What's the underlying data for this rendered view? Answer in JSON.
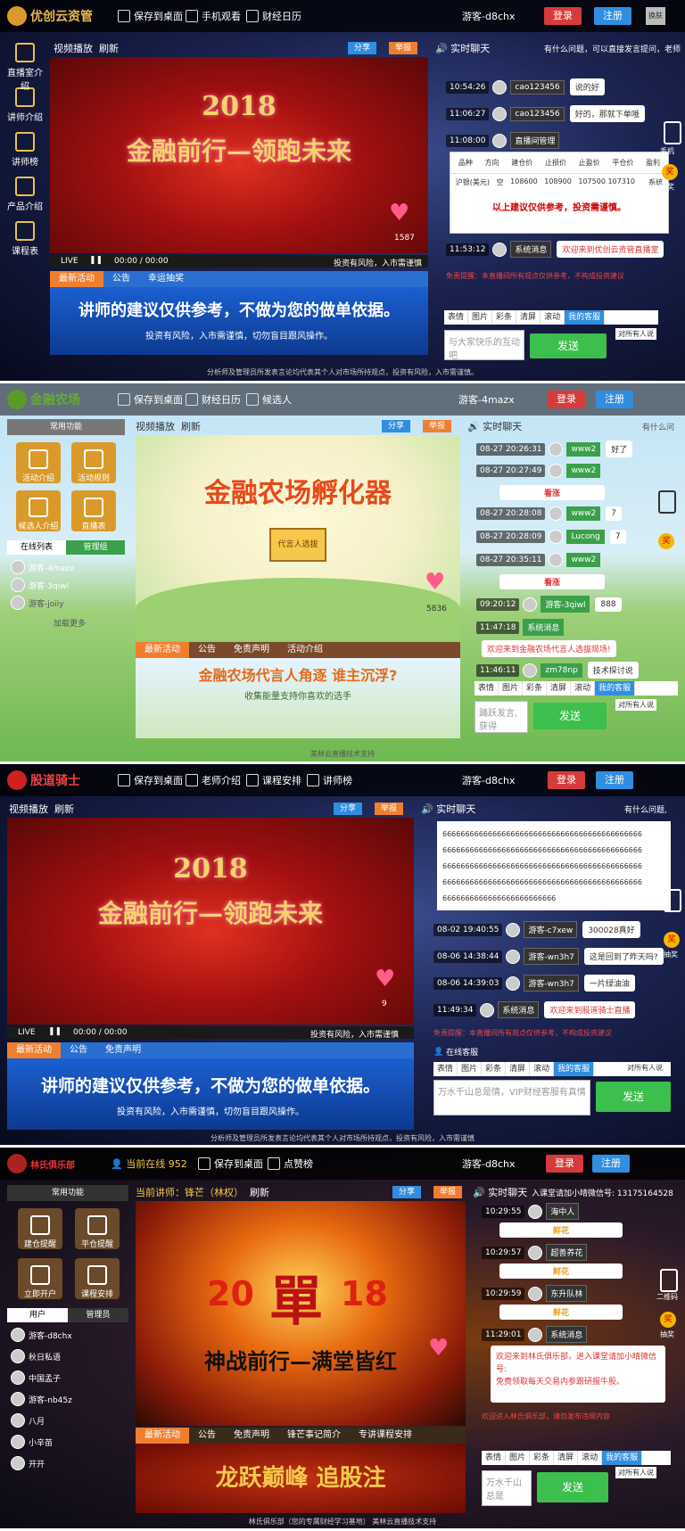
{
  "panel1": {
    "logo": "优创云资管",
    "nav": [
      "保存到桌面",
      "手机观看",
      "财经日历"
    ],
    "guest": "游客-d8chx",
    "login": "登录",
    "register": "注册",
    "small_btn": "换肤",
    "sidebar": [
      "直播室介绍",
      "讲师介绍",
      "讲师榜",
      "产品介绍",
      "课程表"
    ],
    "video_title": "视频播放",
    "refresh": "刷新",
    "share": "分享",
    "report": "举报",
    "video_year": "2018",
    "video_slogan": "金融前行—领跑未来",
    "likes": "1587",
    "live": "LIVE",
    "time": "00:00 / 00:00",
    "risk": "投资有风险，入市需谨慎",
    "tabs": [
      "最新活动",
      "公告",
      "幸运抽奖"
    ],
    "banner_main": "讲师的建议仅供参考，不做为您的做单依据。",
    "banner_sub": "投资有风险，入市需谨慎，切勿盲目跟风操作。",
    "chat_title": "实时聊天",
    "chat_notice": "有什么问题，可以直接发言提问，老师",
    "messages": [
      {
        "time": "10:54:26",
        "name": "cao123456",
        "text": "说的好"
      },
      {
        "time": "11:06:27",
        "name": "cao123456",
        "text": "好的，那就下单哦"
      },
      {
        "time": "11:08:00",
        "name": "直播间管理",
        "text": ""
      },
      {
        "time": "11:53:12",
        "name": "系统消息",
        "text": "欢迎来到优创云资管直播室"
      }
    ],
    "table_header": [
      "品种",
      "方向",
      "建仓价",
      "止损价",
      "止盈价",
      "平仓价",
      "盈利"
    ],
    "table_row": [
      "沪银(美元)",
      "空",
      "108600",
      "108900",
      "107500 107310",
      "",
      "系统"
    ],
    "table_note": "以上建议仅供参考，投资需谨慎。",
    "ticker": "免责提醒：本直播间所有观点仅供参考，不构成投资建议",
    "tools": [
      "表情",
      "图片",
      "彩条",
      "清屏",
      "滚动",
      "我的客服"
    ],
    "input_placeholder": "与大家快乐的互动吧",
    "send": "发送",
    "target": "对所有人说",
    "right_labels": [
      "手机",
      "抽奖"
    ],
    "footer": "分析师及管理员所发表言论均代表其个人对市场所持观点，投资有风险，入市需谨慎。"
  },
  "panel2": {
    "logo": "金融农场",
    "nav": [
      "保存到桌面",
      "财经日历",
      "候选人"
    ],
    "guest": "游客-4mazx",
    "login": "登录",
    "register": "注册",
    "common_func": "常用功能",
    "func_btns": [
      "活动介绍",
      "活动规则",
      "候选人介绍",
      "直播表"
    ],
    "list_tabs": [
      "在线列表",
      "管理组"
    ],
    "users": [
      "游客-4mazx",
      "游客-3qiwl",
      "游客-joiiy"
    ],
    "load_more": "加载更多",
    "video_title": "视频播放",
    "refresh": "刷新",
    "share": "分享",
    "report": "举报",
    "video_slogan": "金融农场孵化器",
    "sign": "代言人选拔",
    "likes": "5836",
    "tabs": [
      "最新活动",
      "公告",
      "免责声明",
      "活动介绍"
    ],
    "banner_main": "金融农场代言人角逐  谁主沉浮?",
    "banner_sub": "收集能量支持你喜欢的选手",
    "chat_title": "实时聊天",
    "chat_notice": "有什么问",
    "messages": [
      {
        "time": "08-27 20:26:31",
        "name": "www2",
        "text": "好了"
      },
      {
        "time": "08-27 20:27:49",
        "name": "www2",
        "text": ""
      },
      {
        "time": "",
        "name": "",
        "text": "看涨"
      },
      {
        "time": "08-27 20:28:08",
        "name": "www2",
        "text": "7"
      },
      {
        "time": "08-27 20:28:09",
        "name": "Lucong",
        "text": "7"
      },
      {
        "time": "08-27 20:35:11",
        "name": "www2",
        "text": ""
      },
      {
        "time": "",
        "name": "",
        "text": "看涨"
      },
      {
        "time": "09:20:12",
        "name": "游客-3qiwl",
        "text": "888"
      },
      {
        "time": "11:47:18",
        "name": "系统消息",
        "text": ""
      },
      {
        "time": "",
        "name": "",
        "text": "欢迎来到金融农场代言人选拔现场!"
      },
      {
        "time": "11:46:11",
        "name": "zm78np",
        "text": "技术探讨说"
      }
    ],
    "tools": [
      "表情",
      "图片",
      "彩条",
      "清屏",
      "滚动",
      "我的客服"
    ],
    "target": "对所有人说",
    "input_placeholder": "踊跃发言,获得",
    "send": "发送",
    "footer": "美林云直播技术支持"
  },
  "panel3": {
    "logo": "股道骑士",
    "nav": [
      "保存到桌面",
      "老师介绍",
      "课程安排",
      "讲师榜"
    ],
    "guest": "游客-d8chx",
    "login": "登录",
    "register": "注册",
    "video_title": "视频播放",
    "refresh": "刷新",
    "share": "分享",
    "report": "举报",
    "video_year": "2018",
    "video_slogan": "金融前行—领跑未来",
    "likes": "9",
    "live": "LIVE",
    "time": "00:00 / 00:00",
    "risk": "投资有风险，入市需谨慎",
    "tabs": [
      "最新活动",
      "公告",
      "免责声明"
    ],
    "banner_main": "讲师的建议仅供参考，不做为您的做单依据。",
    "banner_sub": "投资有风险，入市需谨慎，切勿盲目跟风操作。",
    "chat_title": "实时聊天",
    "chat_notice": "有什么问题,",
    "spam": "66666666666666666666666666666666666666666666",
    "spam_last": "6666666666666666666666666",
    "messages": [
      {
        "time": "08-02 19:40:55",
        "name": "游客-c7xew",
        "text": "300028真好"
      },
      {
        "time": "08-06 14:38:44",
        "name": "游客-wn3h7",
        "text": "这是回到了昨天吗?"
      },
      {
        "time": "08-06 14:39:03",
        "name": "游客-wn3h7",
        "text": "一片绿油油"
      },
      {
        "time": "11:49:34",
        "name": "系统消息",
        "text": "欢迎来到股道骑士直播"
      }
    ],
    "ticker": "免责提醒：本直播间所有观点仅供参考，不构成投资建议",
    "service": "在线客服",
    "tools": [
      "表情",
      "图片",
      "彩条",
      "清屏",
      "滚动",
      "我的客服"
    ],
    "target": "对所有人说",
    "input_placeholder": "万水千山总是情，VIP财经客服有真情",
    "send": "发送",
    "right_labels": [
      "手机",
      "抽奖"
    ],
    "footer": "分析师及管理员所发表言论均代表其个人对市场所持观点，投资有风险，入市需谨慎"
  },
  "panel4": {
    "logo": "林氏俱乐部",
    "online": "当前在线 952",
    "nav": [
      "保存到桌面",
      "点赞榜"
    ],
    "guest": "游客-d8chx",
    "login": "登录",
    "register": "注册",
    "common_func": "常用功能",
    "func_btns": [
      "建仓提醒",
      "平仓提醒",
      "立即开户",
      "课程安排"
    ],
    "list_tabs": [
      "用户",
      "管理员"
    ],
    "users": [
      "游客-d8chx",
      "秋日私语",
      "中国孟子",
      "游客-nb45z",
      "八月",
      "小辛苗",
      "开开"
    ],
    "video_title": "当前讲师：锋芒（林权）",
    "refresh": "刷新",
    "share": "分享",
    "report": "举报",
    "video_year": "20",
    "video_year2": "18",
    "video_big": "單",
    "video_slogan": "神战前行—满堂皆红",
    "tabs": [
      "最新活动",
      "公告",
      "免责声明",
      "锋芒事记简介",
      "专讲课程安排"
    ],
    "banner_main": "龙跃巅峰 追股注",
    "chat_title": "实时聊天",
    "chat_notice": "入课堂请加小晴微信号: 13175164528",
    "messages": [
      {
        "time": "10:29:55",
        "name": "海中人",
        "text": ""
      },
      {
        "time": "",
        "name": "",
        "text": "鲜花"
      },
      {
        "time": "10:29:57",
        "name": "超善养花",
        "text": ""
      },
      {
        "time": "",
        "name": "",
        "text": "鲜花"
      },
      {
        "time": "10:29:59",
        "name": "东升队林",
        "text": ""
      },
      {
        "time": "",
        "name": "",
        "text": "鲜花"
      },
      {
        "time": "11:29:01",
        "name": "系统消息",
        "text": ""
      }
    ],
    "welcome": "欢迎来到林氏俱乐部，进入课堂请加小晴微信号:",
    "welcome2": "免费领取每天交易内参跟研报牛股。",
    "ticker": "欢迎进入林氏俱乐部，请勿发布违规内容",
    "tools": [
      "表情",
      "图片",
      "彩条",
      "清屏",
      "滚动",
      "我的客服"
    ],
    "target": "对所有人说",
    "input_placeholder": "万水千山总是",
    "send": "发送",
    "right_labels": [
      "二维码",
      "抽奖"
    ],
    "footer": "林氏俱乐部（您的专属财经学习基地）   美林云直播技术支持"
  }
}
